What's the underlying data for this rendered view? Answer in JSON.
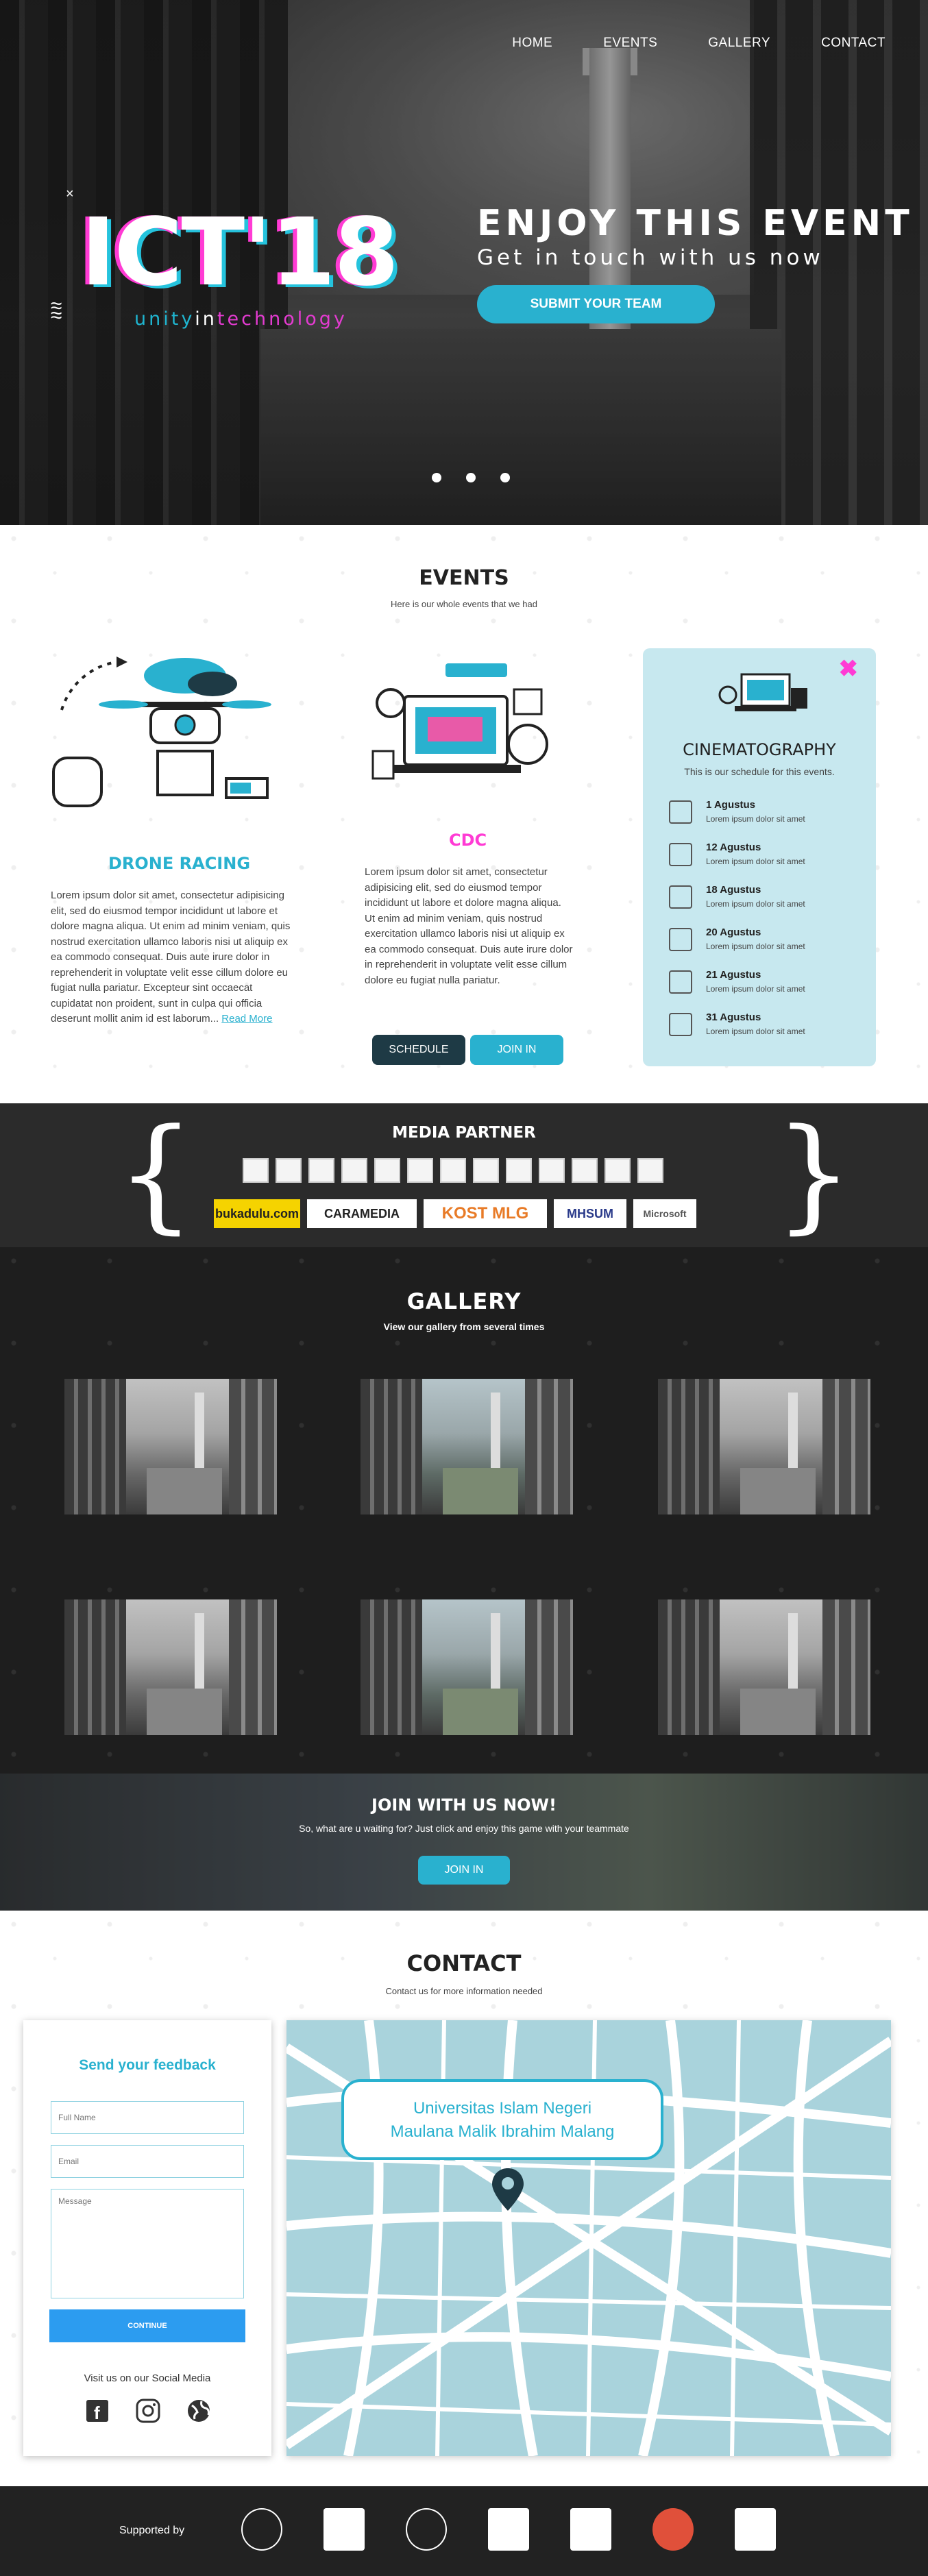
{
  "nav": {
    "home": "HOME",
    "events": "EVENTS",
    "gallery": "GALLERY",
    "contact": "CONTACT"
  },
  "hero": {
    "logo_text": "ICT'18",
    "tagline_a": "unity",
    "tagline_b": "in",
    "tagline_c": "technology",
    "headline": "ENJOY THIS EVENT",
    "subheadline": "Get in touch with us now",
    "cta": "SUBMIT YOUR TEAM",
    "slide_count": 3
  },
  "events": {
    "title": "EVENTS",
    "subtitle": "Here is our whole events that we had",
    "drone": {
      "title": "DRONE RACING",
      "body": "Lorem ipsum dolor sit amet, consectetur adipisicing elit, sed do eiusmod tempor incididunt ut labore et dolore magna aliqua. Ut enim ad minim veniam, quis nostrud exercitation ullamco laboris nisi ut aliquip ex ea commodo consequat. Duis aute irure dolor in reprehenderit in voluptate velit esse cillum dolore eu fugiat nulla pariatur. Excepteur sint occaecat cupidatat non proident, sunt in culpa qui officia deserunt mollit anim id est laborum...",
      "more": "Read More"
    },
    "cdc": {
      "title": "CDC",
      "body": "Lorem ipsum dolor sit amet, consectetur adipisicing elit, sed do eiusmod tempor incididunt ut labore et dolore magna aliqua. Ut enim ad minim veniam, quis nostrud exercitation ullamco laboris nisi ut aliquip ex ea commodo consequat. Duis aute irure dolor in reprehenderit in voluptate velit esse cillum dolore eu fugiat nulla pariatur.",
      "schedule": "SCHEDULE",
      "join": "JOIN IN"
    },
    "cine": {
      "close": "✖",
      "title": "CINEMATOGRAPHY",
      "subtitle": "This is our schedule for this events.",
      "items": [
        {
          "date": "1 Agustus",
          "text": "Lorem ipsum dolor sit amet"
        },
        {
          "date": "12 Agustus",
          "text": "Lorem ipsum dolor sit amet"
        },
        {
          "date": "18 Agustus",
          "text": "Lorem ipsum dolor sit amet"
        },
        {
          "date": "20 Agustus",
          "text": "Lorem ipsum dolor sit amet"
        },
        {
          "date": "21 Agustus",
          "text": "Lorem ipsum dolor sit amet"
        },
        {
          "date": "31 Agustus",
          "text": "Lorem ipsum dolor sit amet"
        }
      ]
    }
  },
  "media": {
    "title": "MEDIA PARTNER",
    "logos": [
      "bukadulu.com",
      "CARAMEDIA",
      "KOST MLG",
      "MHSUM",
      "Microsoft"
    ]
  },
  "gallery": {
    "title": "GALLERY",
    "subtitle": "View our gallery from several times"
  },
  "join": {
    "title": "JOIN WITH US NOW!",
    "text": "So, what are u waiting for? Just click and enjoy this game with your teammate",
    "button": "JOIN IN"
  },
  "contact": {
    "title": "CONTACT",
    "subtitle": "Contact us for more information needed",
    "form_title": "Send your feedback",
    "name_placeholder": "Full Name",
    "email_placeholder": "Email",
    "message_placeholder": "Message",
    "submit": "CONTINUE",
    "social_label": "Visit us on our Social Media",
    "map_line1": "Universitas Islam Negeri",
    "map_line2": "Maulana Malik Ibrahim Malang"
  },
  "footer": {
    "supported_by": "Supported by"
  },
  "colors": {
    "accent": "#29b1cf",
    "magenta": "#ff3bd4",
    "dark": "#1e3a45"
  }
}
